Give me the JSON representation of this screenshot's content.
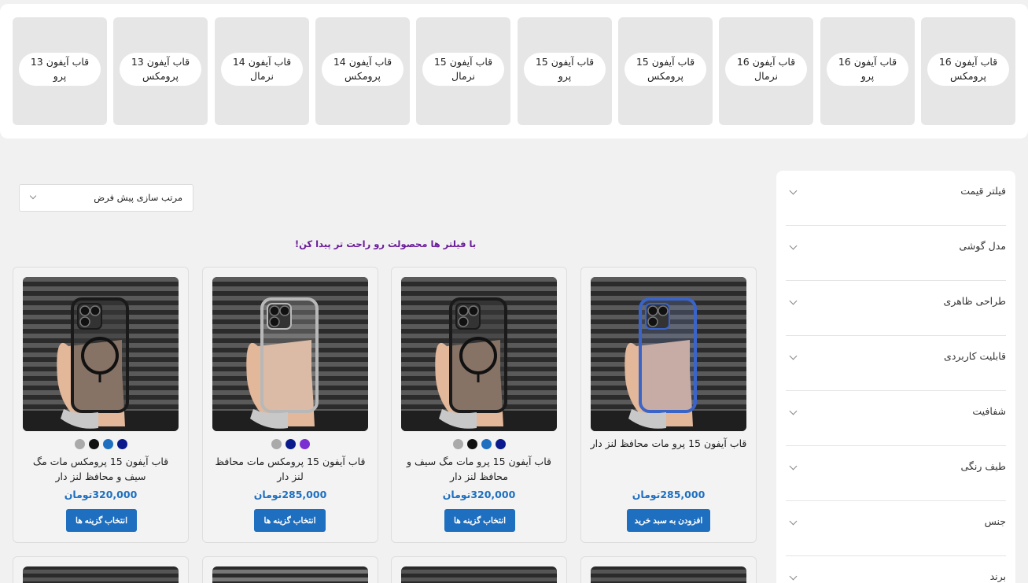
{
  "categories": [
    {
      "label": "قاب آیفون 16 پرومکس"
    },
    {
      "label": "قاب آیفون 16 پرو"
    },
    {
      "label": "قاب آیفون 16 نرمال"
    },
    {
      "label": "قاب آیفون 15 پرومکس"
    },
    {
      "label": "قاب آیفون 15 پرو"
    },
    {
      "label": "قاب آیفون 15 نرمال"
    },
    {
      "label": "قاب آیفون 14 پرومکس"
    },
    {
      "label": "قاب آیفون 14 نرمال"
    },
    {
      "label": "قاب آیفون 13 پرومکس"
    },
    {
      "label": "قاب آیفون 13 پرو"
    }
  ],
  "filters": [
    {
      "label": "فیلتر قیمت"
    },
    {
      "label": "مدل گوشی"
    },
    {
      "label": "طراحی ظاهری"
    },
    {
      "label": "قابلیت کاربردی"
    },
    {
      "label": "شفافیت"
    },
    {
      "label": "طیف رنگی"
    },
    {
      "label": "جنس"
    },
    {
      "label": "برند"
    }
  ],
  "sort": {
    "label": "مرتب سازی پیش فرض"
  },
  "hint": "با فیلتر ها محصولت رو راحت تر پیدا کن!",
  "products": [
    {
      "title": "قاب آیفون 15 پرو مات محافظ لنز دار",
      "price": "285,000تومان",
      "button": "افزودن به سبد خرید",
      "case_color": "blue",
      "swatches": []
    },
    {
      "title": "قاب آیفون 15 پرو مات مگ سیف و محافظ لنز دار",
      "price": "320,000تومان",
      "button": "انتخاب گزینه ها",
      "case_color": "black-magsafe",
      "swatches": [
        "#aaaaaa",
        "#111111",
        "#1e6fc0",
        "#0a1a8c"
      ]
    },
    {
      "title": "قاب آیفون 15 پرومکس مات محافظ لنز دار",
      "price": "285,000تومان",
      "button": "انتخاب گزینه ها",
      "case_color": "silver",
      "swatches": [
        "#aaaaaa",
        "#0a1a8c",
        "#7b2fd0"
      ]
    },
    {
      "title": "قاب آیفون 15 پرومکس مات مگ سیف و محافظ لنز دار",
      "price": "320,000تومان",
      "button": "انتخاب گزینه ها",
      "case_color": "black-magsafe",
      "swatches": [
        "#aaaaaa",
        "#111111",
        "#1e6fc0",
        "#0a1a8c"
      ]
    }
  ],
  "colors": {
    "accent": "#1e6fc0",
    "hint": "#6a1b9a",
    "tile": "#e6e6e6"
  }
}
